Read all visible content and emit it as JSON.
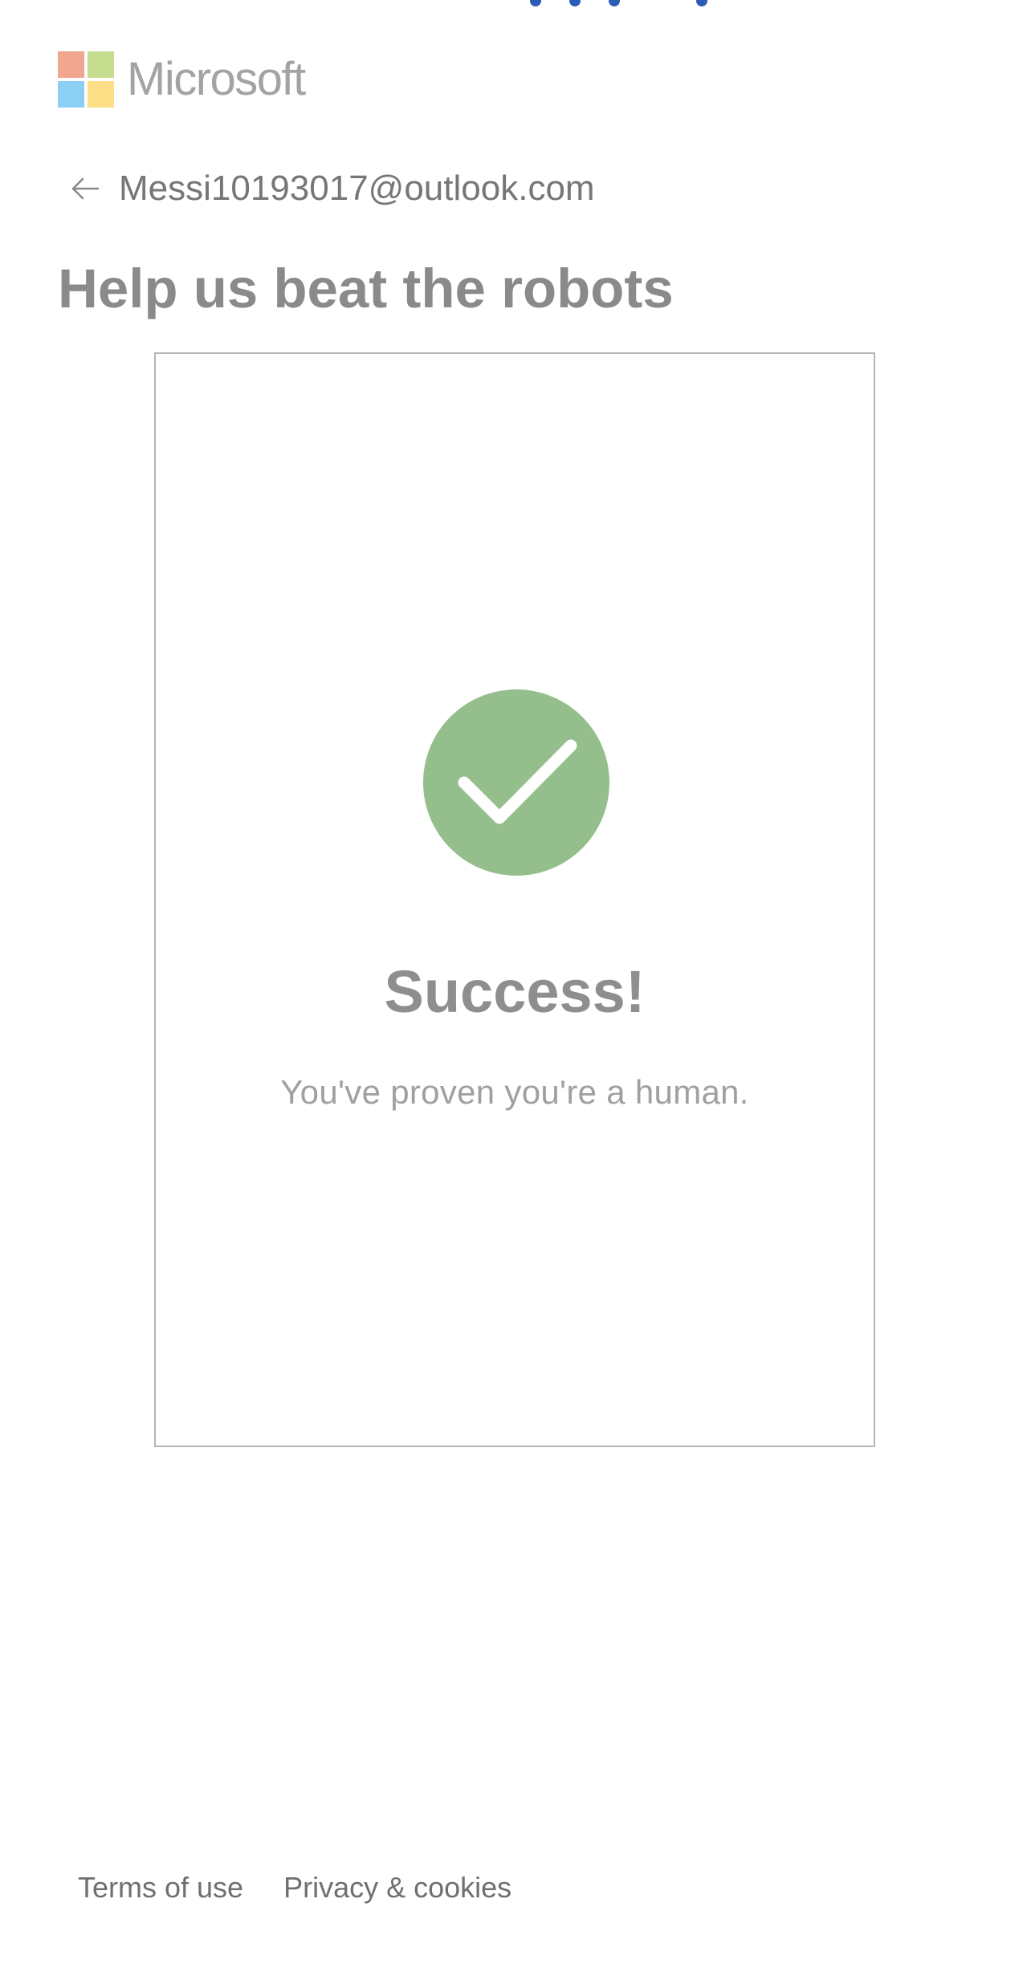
{
  "brand": {
    "name": "Microsoft",
    "colors": {
      "red": "#f1a68f",
      "green": "#c4dd8e",
      "blue": "#8ccff5",
      "yellow": "#fcdf87"
    }
  },
  "identity": {
    "back_icon": "arrow-left-icon",
    "email": "Messi10193017@outlook.com"
  },
  "page": {
    "title": "Help us beat the robots"
  },
  "challenge": {
    "status_icon": "checkmark-circle-icon",
    "status_color": "#94be8c",
    "title": "Success!",
    "message": "You've proven you're a human."
  },
  "footer": {
    "links": [
      {
        "label": "Terms of use"
      },
      {
        "label": "Privacy & cookies"
      }
    ]
  }
}
